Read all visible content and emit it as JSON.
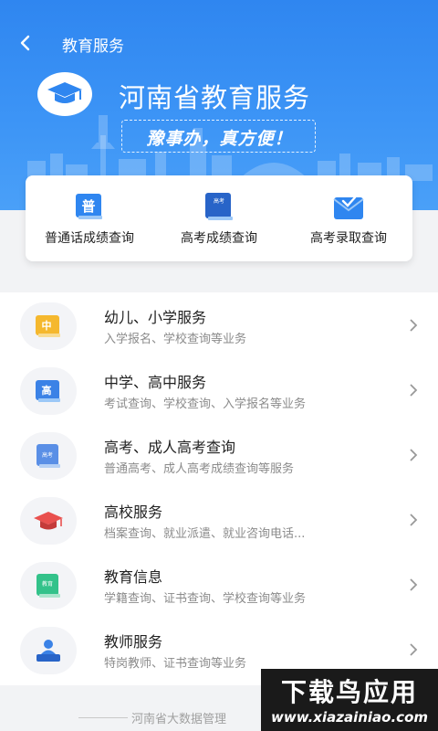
{
  "nav": {
    "title": "教育服务",
    "back_icon": "chevron-left-icon"
  },
  "hero": {
    "title": "河南省教育服务",
    "slogan": "豫事办，真方便！",
    "logo_icon": "graduation-cap-icon",
    "gradient_top": "#2f86f0",
    "gradient_bottom": "#4aa0f8"
  },
  "quick_actions": [
    {
      "label": "普通话成绩查询",
      "icon": "putonghua-book-icon",
      "icon_text": "普"
    },
    {
      "label": "高考成绩查询",
      "icon": "gaokao-book-icon",
      "icon_text": "高考"
    },
    {
      "label": "高考录取查询",
      "icon": "admission-envelope-icon"
    }
  ],
  "services": [
    {
      "title": "幼儿、小学服务",
      "subtitle": "入学报名、学校查询等业务",
      "icon": "primary-school-book-icon",
      "icon_text": "中",
      "color": "#f5b82e"
    },
    {
      "title": "中学、高中服务",
      "subtitle": "考试查询、学校查询、入学报名等业务",
      "icon": "high-school-book-icon",
      "icon_text": "高",
      "color": "#3b82e6"
    },
    {
      "title": "高考、成人高考查询",
      "subtitle": "普通高考、成人高考成绩查询等服务",
      "icon": "exam-book-icon",
      "icon_text": "高考",
      "color": "#5a8fe6"
    },
    {
      "title": "高校服务",
      "subtitle": "档案查询、就业派遣、就业咨询电话...",
      "icon": "graduation-cap-icon",
      "color": "#e9504e"
    },
    {
      "title": "教育信息",
      "subtitle": "学籍查询、证书查询、学校查询等业务",
      "icon": "education-book-icon",
      "icon_text": "教育",
      "color": "#33c28a"
    },
    {
      "title": "教师服务",
      "subtitle": "特岗教师、证书查询等业务",
      "icon": "teacher-podium-icon",
      "color": "#3b82e6"
    }
  ],
  "footer": {
    "text": "河南省大数据管理"
  },
  "watermark": {
    "line1": "下载鸟应用",
    "line2": "www.xiazainiao.com"
  }
}
